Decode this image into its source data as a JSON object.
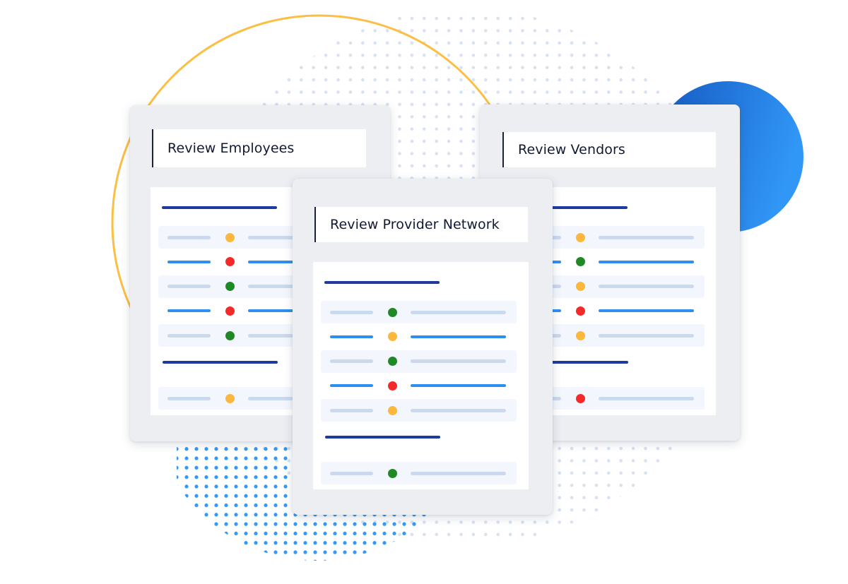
{
  "colors": {
    "yellow_ring": "#fbbf45",
    "blue_circle_start": "#1457c0",
    "blue_circle_end": "#3197f7",
    "grey_dots": "#d6e2f2",
    "blue_dots": "#3499f6",
    "status": {
      "yellow": "#fbb83c",
      "red": "#f42a2a",
      "green": "#1f8a25"
    }
  },
  "cards": [
    {
      "id": "employees",
      "title": "Review Employees",
      "sections": [
        {
          "rows": [
            {
              "status": "yellow",
              "style": "light",
              "shaded": true
            },
            {
              "status": "red",
              "style": "blue",
              "shaded": false
            },
            {
              "status": "green",
              "style": "light",
              "shaded": true
            },
            {
              "status": "red",
              "style": "blue",
              "shaded": false
            },
            {
              "status": "green",
              "style": "light",
              "shaded": true
            }
          ]
        },
        {
          "rows": [
            {
              "status": "yellow",
              "style": "light",
              "shaded": true
            }
          ]
        }
      ]
    },
    {
      "id": "vendors",
      "title": "Review Vendors",
      "sections": [
        {
          "rows": [
            {
              "status": "yellow",
              "style": "light",
              "shaded": true
            },
            {
              "status": "green",
              "style": "blue",
              "shaded": false
            },
            {
              "status": "yellow",
              "style": "light",
              "shaded": true
            },
            {
              "status": "red",
              "style": "blue",
              "shaded": false
            },
            {
              "status": "yellow",
              "style": "light",
              "shaded": true
            }
          ]
        },
        {
          "rows": [
            {
              "status": "red",
              "style": "light",
              "shaded": true
            }
          ]
        }
      ]
    },
    {
      "id": "provider-network",
      "title": "Review Provider Network",
      "sections": [
        {
          "rows": [
            {
              "status": "green",
              "style": "light",
              "shaded": true
            },
            {
              "status": "yellow",
              "style": "blue",
              "shaded": false
            },
            {
              "status": "green",
              "style": "light",
              "shaded": true
            },
            {
              "status": "red",
              "style": "blue",
              "shaded": false
            },
            {
              "status": "yellow",
              "style": "light",
              "shaded": true
            }
          ]
        },
        {
          "rows": [
            {
              "status": "green",
              "style": "light",
              "shaded": true
            }
          ]
        }
      ]
    }
  ]
}
